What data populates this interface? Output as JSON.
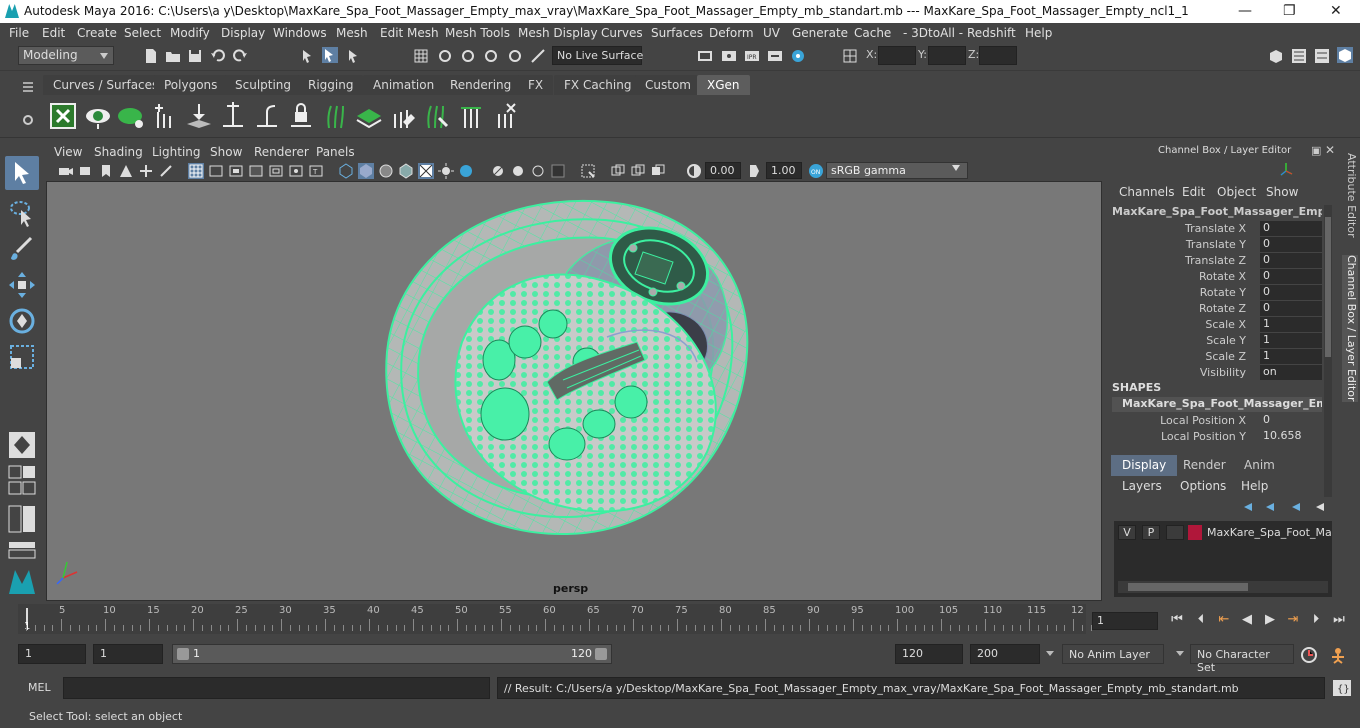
{
  "title_bar": {
    "text": "Autodesk Maya 2016: C:\\Users\\a y\\Desktop\\MaxKare_Spa_Foot_Massager_Empty_max_vray\\MaxKare_Spa_Foot_Massager_Empty_mb_standart.mb   ---   MaxKare_Spa_Foot_Massager_Empty_ncl1_1"
  },
  "menu": [
    "File",
    "Edit",
    "Create",
    "Select",
    "Modify",
    "Display",
    "Windows",
    "Mesh",
    "Edit Mesh",
    "Mesh Tools",
    "Mesh Display",
    "Curves",
    "Surfaces",
    "Deform",
    "UV",
    "Generate",
    "Cache",
    "- 3DtoAll -",
    "Redshift",
    "Help"
  ],
  "status_line": {
    "mode": "Modeling",
    "live_surface": "No Live Surface",
    "x_label": "X:",
    "y_label": "Y:",
    "z_label": "Z:"
  },
  "shelf_tabs": [
    "Curves / Surfaces",
    "Polygons",
    "Sculpting",
    "Rigging",
    "Animation",
    "Rendering",
    "FX",
    "FX Caching",
    "Custom",
    "XGen"
  ],
  "active_shelf_tab": "XGen",
  "viewport": {
    "menus": [
      "View",
      "Shading",
      "Lighting",
      "Show",
      "Renderer",
      "Panels"
    ],
    "exposure": "0.00",
    "gamma": "1.00",
    "color_space": "sRGB gamma",
    "camera": "persp"
  },
  "channel_box": {
    "title": "Channel Box / Layer Editor",
    "menus": [
      "Channels",
      "Edit",
      "Object",
      "Show"
    ],
    "object_name": "MaxKare_Spa_Foot_Massager_Empty_...",
    "attributes": [
      {
        "label": "Translate X",
        "value": "0"
      },
      {
        "label": "Translate Y",
        "value": "0"
      },
      {
        "label": "Translate Z",
        "value": "0"
      },
      {
        "label": "Rotate X",
        "value": "0"
      },
      {
        "label": "Rotate Y",
        "value": "0"
      },
      {
        "label": "Rotate Z",
        "value": "0"
      },
      {
        "label": "Scale X",
        "value": "1"
      },
      {
        "label": "Scale Y",
        "value": "1"
      },
      {
        "label": "Scale Z",
        "value": "1"
      },
      {
        "label": "Visibility",
        "value": "on"
      }
    ],
    "shapes_header": "SHAPES",
    "shape_name": "MaxKare_Spa_Foot_Massager_Empt...",
    "shape_attributes": [
      {
        "label": "Local Position X",
        "value": "0"
      },
      {
        "label": "Local Position Y",
        "value": "10.658"
      }
    ],
    "layer_tabs": [
      "Display",
      "Render",
      "Anim"
    ],
    "layer_menus": [
      "Layers",
      "Options",
      "Help"
    ],
    "layer": {
      "v": "V",
      "p": "P",
      "name": "MaxKare_Spa_Foot_Mass",
      "color": "#b0173a"
    },
    "side_tabs": [
      "Attribute Editor",
      "Channel Box / Layer Editor"
    ]
  },
  "time_slider": {
    "ticks": [
      "5",
      "10",
      "15",
      "20",
      "25",
      "30",
      "35",
      "40",
      "45",
      "50",
      "55",
      "60",
      "65",
      "70",
      "75",
      "80",
      "85",
      "90",
      "95",
      "100",
      "105",
      "110",
      "115",
      "12"
    ],
    "current_marker": "1",
    "current_frame": "1"
  },
  "range": {
    "start": "1",
    "playback_start": "1",
    "slider_start": "1",
    "slider_end": "120",
    "playback_end": "120",
    "end": "200",
    "anim_layer": "No Anim Layer",
    "character_set": "No Character Set"
  },
  "command_line": {
    "label": "MEL",
    "result": "// Result: C:/Users/a y/Desktop/MaxKare_Spa_Foot_Massager_Empty_max_vray/MaxKare_Spa_Foot_Massager_Empty_mb_standart.mb"
  },
  "help_line": "Select Tool: select an object",
  "colors": {
    "wire": "#3cf0a0",
    "accent": "#5e7fa3",
    "layer": "#b0173a"
  }
}
